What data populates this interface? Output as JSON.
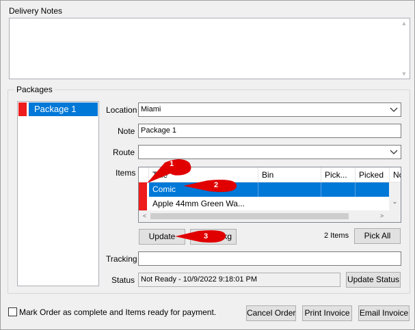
{
  "delivery_notes": {
    "label": "Delivery Notes",
    "value": ""
  },
  "packages": {
    "group_label": "Packages",
    "list": [
      {
        "name": "Package 1",
        "color": "#ee1c1c"
      }
    ]
  },
  "form": {
    "location_label": "Location",
    "location_value": "Miami",
    "note_label": "Note",
    "note_value": "Package 1",
    "route_label": "Route",
    "route_value": "",
    "items_label": "Items",
    "tracking_label": "Tracking",
    "tracking_value": "",
    "status_label": "Status",
    "status_value": "Not Ready - 10/9/2022 9:18:01 PM"
  },
  "items_grid": {
    "columns": [
      "Title",
      "Bin",
      "Pick...",
      "Picked",
      "Nc"
    ],
    "rows": [
      {
        "title": "Comic",
        "bin": "",
        "pick": "",
        "picked": "",
        "selected": true,
        "color": "#ee1c1c"
      },
      {
        "title": "Apple 44mm Green Wa...",
        "bin": "",
        "pick": "",
        "picked": "",
        "selected": false,
        "color": "#ee1c1c"
      }
    ]
  },
  "buttons": {
    "update": "Update",
    "remove_pkg_partial": "kg",
    "items_count": "2 Items",
    "pick_all": "Pick All",
    "update_status": "Update Status",
    "cancel_order": "Cancel Order",
    "print_invoice": "Print Invoice",
    "email_invoice": "Email Invoice"
  },
  "mark_complete": {
    "label": "Mark Order as complete and Items ready for payment.",
    "checked": false
  },
  "callouts": [
    "1",
    "2",
    "3"
  ],
  "colors": {
    "selection": "#0078d7",
    "callout_red": "#e00000",
    "package_swatch": "#ee1c1c"
  }
}
